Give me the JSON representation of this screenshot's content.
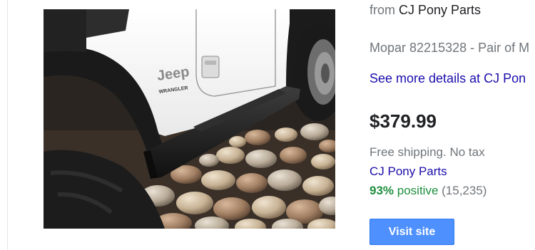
{
  "offer": {
    "from_prefix": "from",
    "seller_name": "CJ Pony Parts",
    "description": "Mopar 82215328 - Pair of M",
    "details_link": "See more details at CJ Pon",
    "price": "$379.99",
    "shipping": "Free shipping. No tax",
    "merchant": "CJ Pony Parts",
    "rating_percent": "93%",
    "rating_label": "positive",
    "rating_count": "(15,235)",
    "visit_button": "Visit site"
  },
  "image": {
    "badge_text": "Jeep",
    "badge_sub": "WRANGLER"
  },
  "colors": {
    "link": "#1a0dab",
    "positive": "#1e8e3e",
    "muted": "#70757a",
    "button": "#4d90fe"
  }
}
